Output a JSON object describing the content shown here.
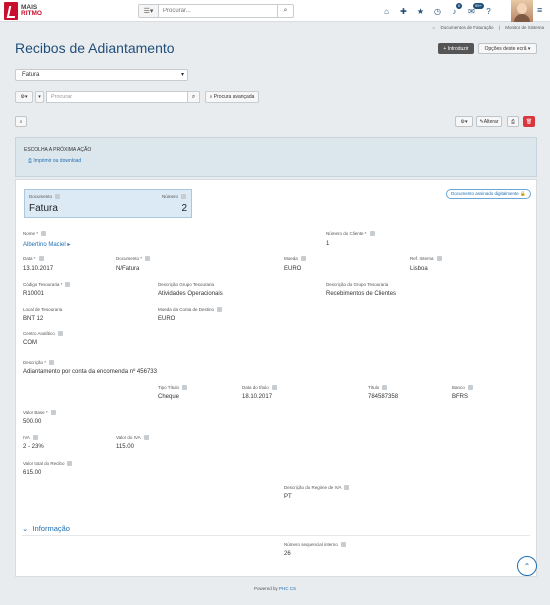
{
  "app": {
    "logo_line1": "MAIS",
    "logo_line2": "RITMO"
  },
  "topbar": {
    "search_placeholder": "Procurar...",
    "badges": {
      "notifications": "6",
      "messages": "99+"
    }
  },
  "breadcrumb": [
    "Documentos de Faturação",
    "Monitor de Sistema"
  ],
  "page": {
    "title": "Recibos de Adiantamento",
    "introduce_label": "+ Introduzir",
    "options_label": "Opções deste ecrã ▾",
    "doc_type_selected": "Fatura",
    "filter_placeholder": "Procurar",
    "advanced_search_label": "Procura avançada",
    "alter_label": "Alterar"
  },
  "action_panel": {
    "title": "ESCOLHA A PRÓXIMA AÇÃO",
    "link": "Imprimir ou download"
  },
  "record": {
    "signed_badge": "Documento assinado digitalmente",
    "documento_label": "Documento",
    "documento_value": "Fatura",
    "numero_label": "Número",
    "numero_value": "2",
    "nome_label": "Nome *",
    "nome_value": "Albertino Maciel",
    "numero_cliente_label": "Número do Cliente *",
    "numero_cliente_value": "1",
    "data_label": "Data *",
    "data_value": "13.10.2017",
    "documento2_label": "Documento *",
    "documento2_value": "N/Fatura",
    "moeda_label": "Moeda",
    "moeda_value": "EURO",
    "ref_interna_label": "Ref. Interna",
    "ref_interna_value": "Lisboa",
    "codigo_tesouraria_label": "Código Tesouraria *",
    "codigo_tesouraria_value": "R10001",
    "desc_grupo_label": "Descrição Grupo Tesouraria",
    "desc_grupo_value": "Atividades Operacionais",
    "desc_do_grupo_label": "Descrição do Grupo Tesouraria",
    "desc_do_grupo_value": "Recebimentos de Clientes",
    "local_label": "Local de Tesouraria",
    "local_value": "BNT 12",
    "moeda_conta_label": "Moeda da Conta de Destino",
    "moeda_conta_value": "EURO",
    "centro_label": "Centro Analítico",
    "centro_value": "COM",
    "descricao_label": "Descrição *",
    "descricao_value": "Adiantamento por conta da encomenda nº 456733",
    "tipo_titulo_label": "Tipo Título",
    "tipo_titulo_value": "Cheque",
    "data_titulo_label": "Data do título",
    "data_titulo_value": "18.10.2017",
    "titulo_label": "Título",
    "titulo_value": "784587358",
    "banco_label": "Banco",
    "banco_value": "BFRS",
    "valor_base_label": "Valor Base *",
    "valor_base_value": "500.00",
    "iva_label": "IVA",
    "iva_value": "2 - 23%",
    "valor_iva_label": "Valor do IVA",
    "valor_iva_value": "115.00",
    "valor_total_label": "Valor total do Recibo",
    "valor_total_value": "615.00",
    "regime_label": "Descrição do Regime de IVA",
    "regime_value": "PT",
    "info_section": "Informação",
    "seq_label": "Número sequencial interno",
    "seq_value": "26"
  },
  "footer": {
    "prefix": "Powered by",
    "brand": "PHC CS"
  }
}
